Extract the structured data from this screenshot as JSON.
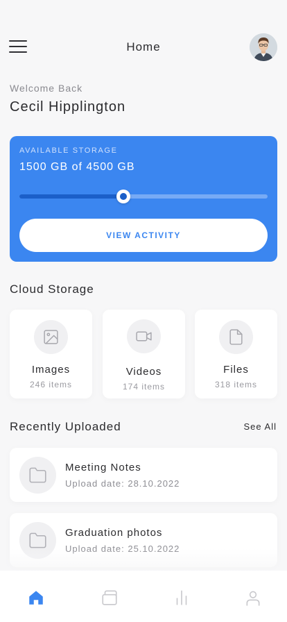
{
  "colors": {
    "accent": "#3b86f0",
    "accent_dark": "#1b5fc9",
    "background": "#f7f7f8",
    "card": "#ffffff",
    "icon_inactive": "#c8c8cc"
  },
  "header": {
    "title": "Home",
    "menu_icon": "hamburger-menu-icon",
    "avatar": "user-avatar-photo"
  },
  "greeting": {
    "welcome": "Welcome Back",
    "name": "Cecil Hipplington"
  },
  "storage": {
    "caption": "AVAILABLE STORAGE",
    "value_text": "1500 GB of 4500 GB",
    "used_gb": 1500,
    "total_gb": 4500,
    "slider_fraction": 0.42,
    "button_label": "VIEW ACTIVITY"
  },
  "cloud": {
    "title": "Cloud Storage",
    "tiles": [
      {
        "icon": "image-icon",
        "title": "Images",
        "count": "246 items"
      },
      {
        "icon": "video-camera-icon",
        "title": "Videos",
        "count": "174 items"
      },
      {
        "icon": "file-icon",
        "title": "Files",
        "count": "318 items"
      }
    ]
  },
  "recent": {
    "title": "Recently Uploaded",
    "see_all": "See All",
    "items": [
      {
        "icon": "folder-icon",
        "name": "Meeting Notes",
        "date": "Upload date: 28.10.2022"
      },
      {
        "icon": "folder-icon",
        "name": "Graduation photos",
        "date": "Upload date: 25.10.2022"
      }
    ]
  },
  "nav": {
    "items": [
      {
        "icon": "home-icon",
        "active": true
      },
      {
        "icon": "folders-icon",
        "active": false
      },
      {
        "icon": "stats-icon",
        "active": false
      },
      {
        "icon": "profile-icon",
        "active": false
      }
    ]
  }
}
